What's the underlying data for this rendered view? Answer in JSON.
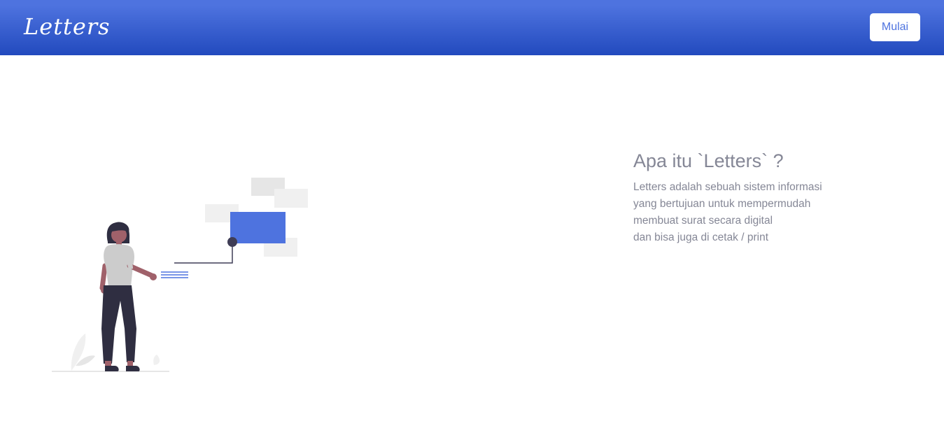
{
  "navbar": {
    "brand": "Letters",
    "start_button": "Mulai"
  },
  "about": {
    "title": "Apa itu `Letters` ?",
    "lines": [
      "Letters adalah sebuah sistem informasi",
      "yang bertujuan untuk mempermudah",
      "membuat surat secara digital",
      "dan bisa juga di cetak / print"
    ]
  },
  "colors": {
    "primary": "#4e73df",
    "primary_dark": "#224abe",
    "text_muted": "#858796"
  },
  "illustration": {
    "icon": "person-presenting-illustration"
  }
}
